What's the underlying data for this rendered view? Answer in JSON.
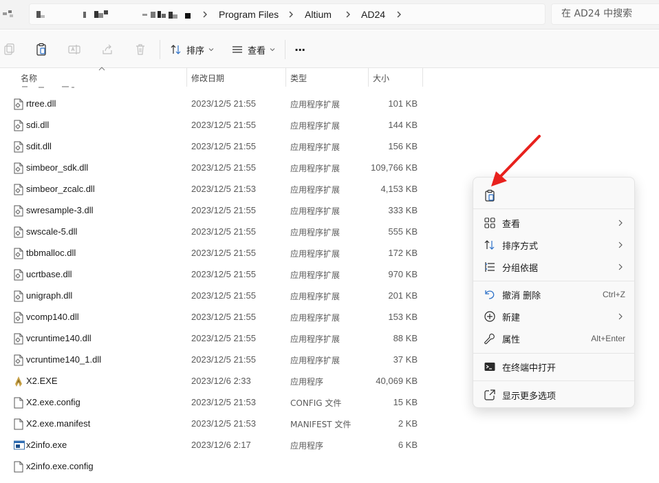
{
  "address": {
    "crumbs": [
      "Program Files",
      "Altium",
      "AD24"
    ]
  },
  "search": {
    "placeholder": "在 AD24 中搜索"
  },
  "toolbar": {
    "sort_label": "排序",
    "view_label": "查看",
    "more_label": "···"
  },
  "columns": {
    "name": "名称",
    "date": "修改日期",
    "type": "类型",
    "size": "大小"
  },
  "files": [
    {
      "name": "rtree.dll",
      "date": "2023/12/5 21:55",
      "type": "应用程序扩展",
      "size": "101 KB",
      "icon": "dll-icon"
    },
    {
      "name": "sdi.dll",
      "date": "2023/12/5 21:55",
      "type": "应用程序扩展",
      "size": "144 KB",
      "icon": "dll-icon"
    },
    {
      "name": "sdit.dll",
      "date": "2023/12/5 21:55",
      "type": "应用程序扩展",
      "size": "156 KB",
      "icon": "dll-icon"
    },
    {
      "name": "simbeor_sdk.dll",
      "date": "2023/12/5 21:55",
      "type": "应用程序扩展",
      "size": "109,766 KB",
      "icon": "dll-icon"
    },
    {
      "name": "simbeor_zcalc.dll",
      "date": "2023/12/5 21:53",
      "type": "应用程序扩展",
      "size": "4,153 KB",
      "icon": "dll-icon"
    },
    {
      "name": "swresample-3.dll",
      "date": "2023/12/5 21:55",
      "type": "应用程序扩展",
      "size": "333 KB",
      "icon": "dll-icon"
    },
    {
      "name": "swscale-5.dll",
      "date": "2023/12/5 21:55",
      "type": "应用程序扩展",
      "size": "555 KB",
      "icon": "dll-icon"
    },
    {
      "name": "tbbmalloc.dll",
      "date": "2023/12/5 21:55",
      "type": "应用程序扩展",
      "size": "172 KB",
      "icon": "dll-icon"
    },
    {
      "name": "ucrtbase.dll",
      "date": "2023/12/5 21:55",
      "type": "应用程序扩展",
      "size": "970 KB",
      "icon": "dll-icon"
    },
    {
      "name": "unigraph.dll",
      "date": "2023/12/5 21:55",
      "type": "应用程序扩展",
      "size": "201 KB",
      "icon": "dll-icon"
    },
    {
      "name": "vcomp140.dll",
      "date": "2023/12/5 21:55",
      "type": "应用程序扩展",
      "size": "153 KB",
      "icon": "dll-icon"
    },
    {
      "name": "vcruntime140.dll",
      "date": "2023/12/5 21:55",
      "type": "应用程序扩展",
      "size": "88 KB",
      "icon": "dll-icon"
    },
    {
      "name": "vcruntime140_1.dll",
      "date": "2023/12/5 21:55",
      "type": "应用程序扩展",
      "size": "37 KB",
      "icon": "dll-icon"
    },
    {
      "name": "X2.EXE",
      "date": "2023/12/6 2:33",
      "type": "应用程序",
      "size": "40,069 KB",
      "icon": "altium-exe-icon"
    },
    {
      "name": "X2.exe.config",
      "date": "2023/12/5 21:53",
      "type": "CONFIG 文件",
      "size": "15 KB",
      "icon": "file-icon"
    },
    {
      "name": "X2.exe.manifest",
      "date": "2023/12/5 21:53",
      "type": "MANIFEST 文件",
      "size": "2 KB",
      "icon": "file-icon"
    },
    {
      "name": "x2info.exe",
      "date": "2023/12/6 2:17",
      "type": "应用程序",
      "size": "6 KB",
      "icon": "exe-window-icon"
    },
    {
      "name": "x2info.exe.config",
      "date": "",
      "type": "",
      "size": "",
      "icon": "file-icon"
    }
  ],
  "context_menu": {
    "items": [
      {
        "label": "查看",
        "icon": "grid-view-icon",
        "submenu": true
      },
      {
        "label": "排序方式",
        "icon": "sort-icon",
        "submenu": true
      },
      {
        "label": "分组依据",
        "icon": "group-by-icon",
        "submenu": true
      },
      {
        "label": "撤消 删除",
        "icon": "undo-icon",
        "shortcut": "Ctrl+Z"
      },
      {
        "label": "新建",
        "icon": "new-plus-icon",
        "submenu": true
      },
      {
        "label": "属性",
        "icon": "wrench-icon",
        "shortcut": "Alt+Enter"
      },
      {
        "label": "在终端中打开",
        "icon": "terminal-icon"
      },
      {
        "label": "显示更多选项",
        "icon": "more-options-icon"
      }
    ]
  },
  "colors": {
    "accent": "#005fb8",
    "annotation": "#e8211d"
  }
}
